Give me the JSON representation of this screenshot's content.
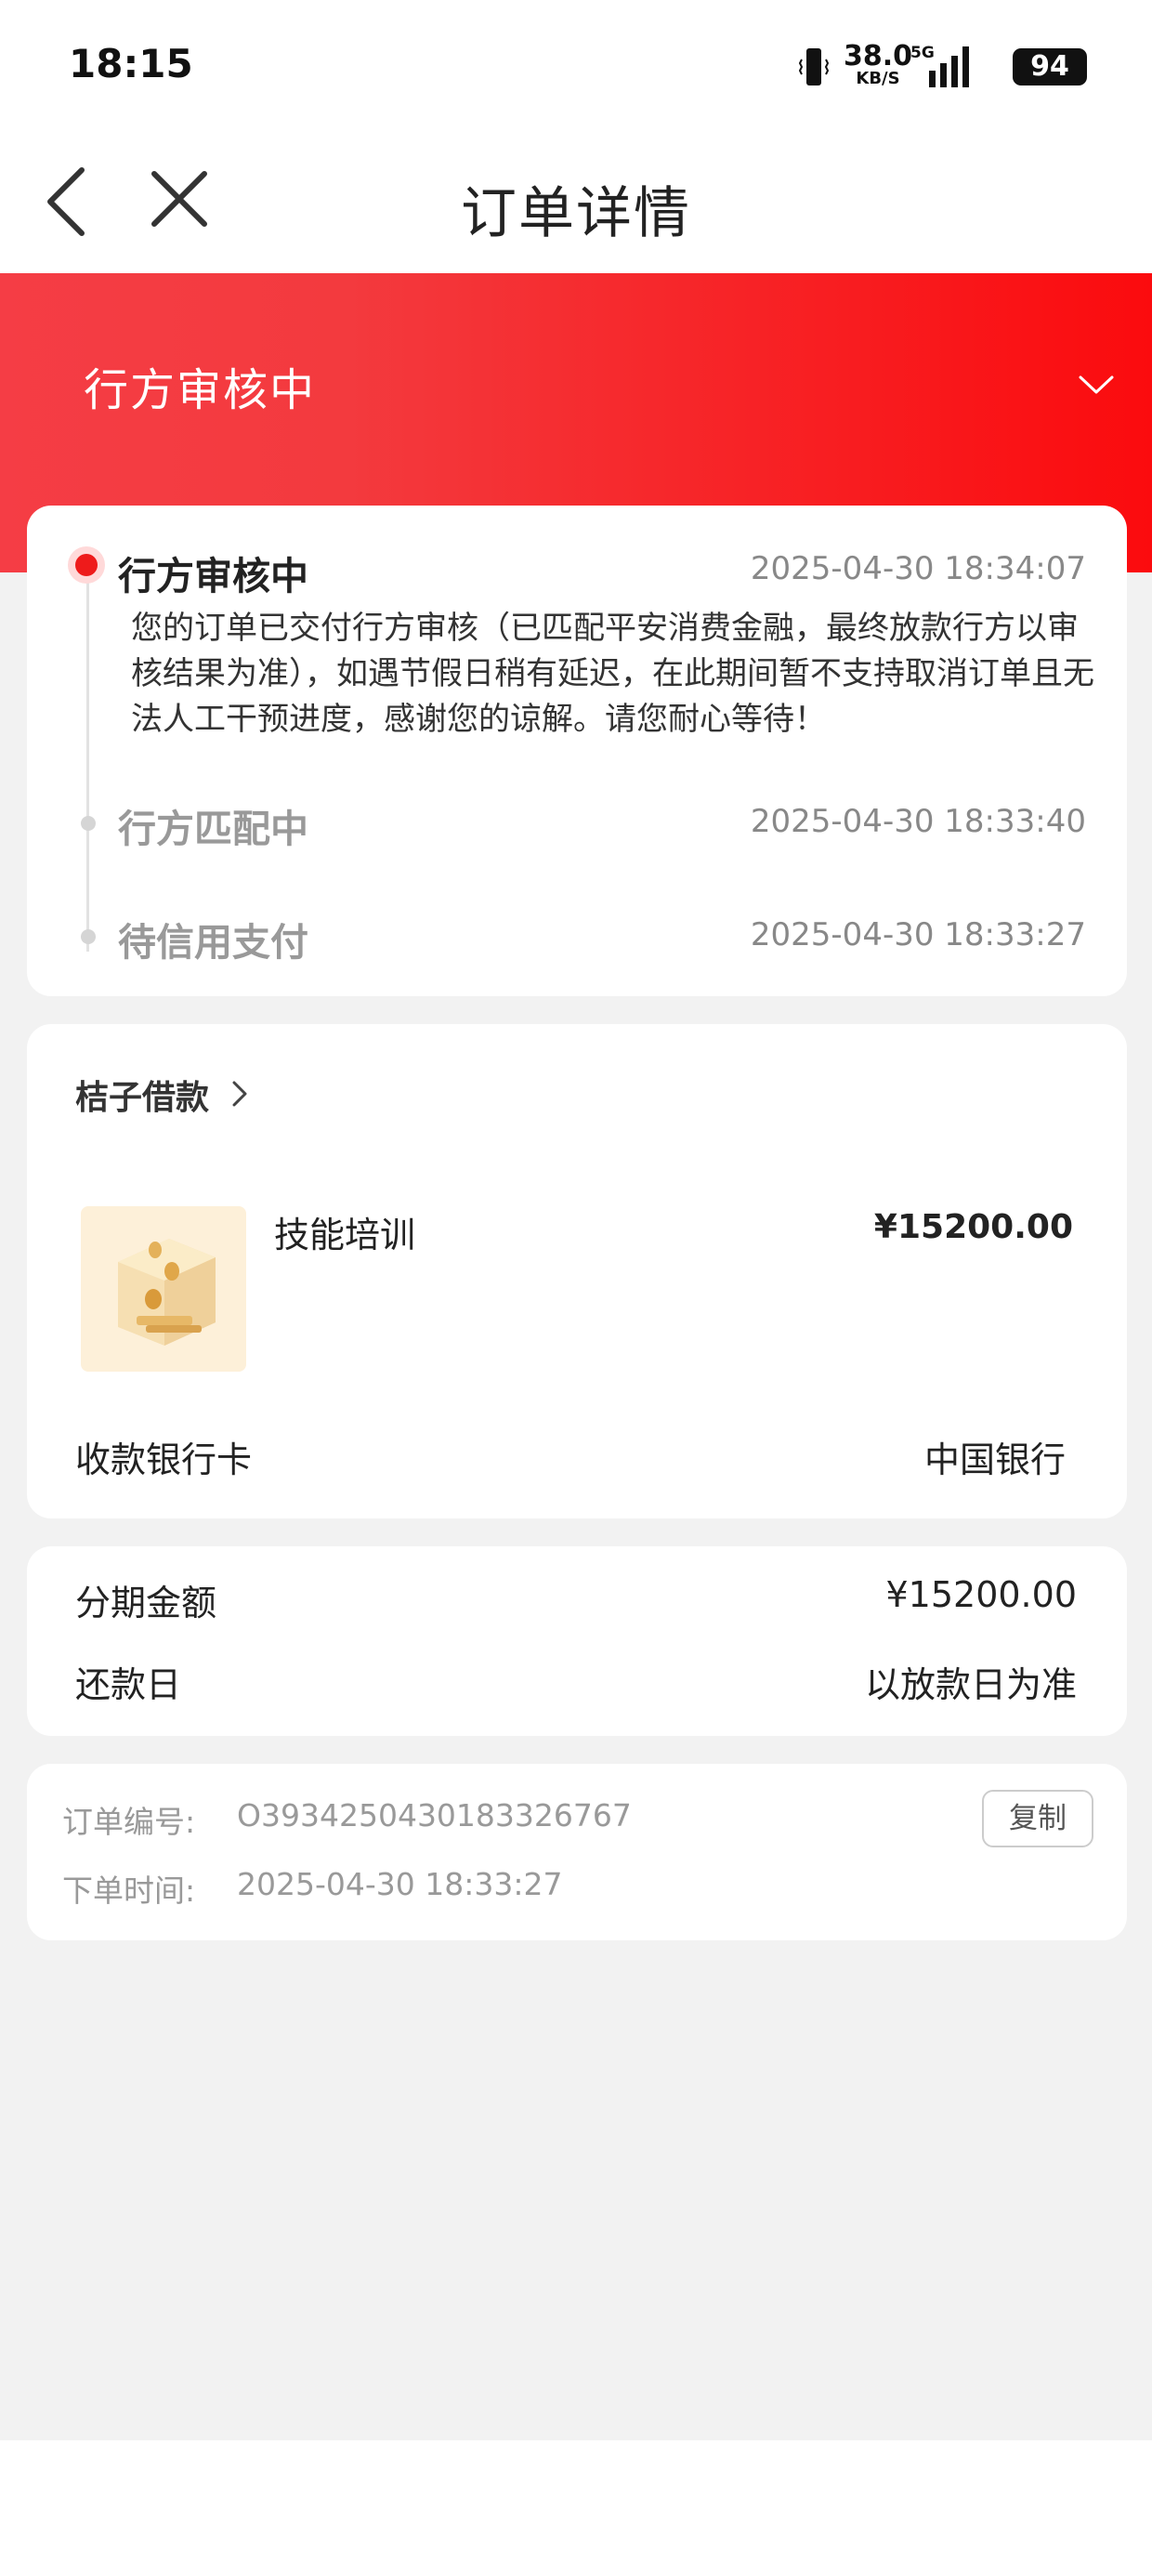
{
  "status_bar": {
    "time": "18:15",
    "net_speed": "38.0",
    "net_unit": "KB/S",
    "network": "5G",
    "battery": "94"
  },
  "nav": {
    "title": "订单详情",
    "back_icon": "chevron-left-icon",
    "close_icon": "close-icon"
  },
  "hero": {
    "status": "行方审核中",
    "toggle_icon": "chevron-down-icon"
  },
  "timeline": {
    "steps": [
      {
        "name": "行方审核中",
        "time": "2025-04-30 18:34:07",
        "desc": "您的订单已交付行方审核（已匹配平安消费金融，最终放款行方以审核结果为准），如遇节假日稍有延迟，在此期间暂不支持取消订单且无法人工干预进度，感谢您的谅解。请您耐心等待！",
        "active": true
      },
      {
        "name": "行方匹配中",
        "time": "2025-04-30 18:33:40",
        "active": false
      },
      {
        "name": "待信用支付",
        "time": "2025-04-30 18:33:27",
        "active": false
      }
    ]
  },
  "product_card": {
    "merchant": "桔子借款",
    "product_name": "技能培训",
    "price": "¥15200.00",
    "bank_label": "收款银行卡",
    "bank_value": "中国银行"
  },
  "installment": {
    "amount_label": "分期金额",
    "amount_value": "¥15200.00",
    "repay_label": "还款日",
    "repay_value": "以放款日为准"
  },
  "order_info": {
    "order_no_label": "订单编号:",
    "order_no": "O393425043018332676 7",
    "order_time_label": "下单时间:",
    "order_time": "2025-04-30 18:33:27",
    "copy_label": "复制"
  },
  "colors": {
    "accent": "#f01c1c",
    "hero_start": "#f53d45",
    "hero_end": "#fb0b0e",
    "background": "#f2f2f2"
  }
}
